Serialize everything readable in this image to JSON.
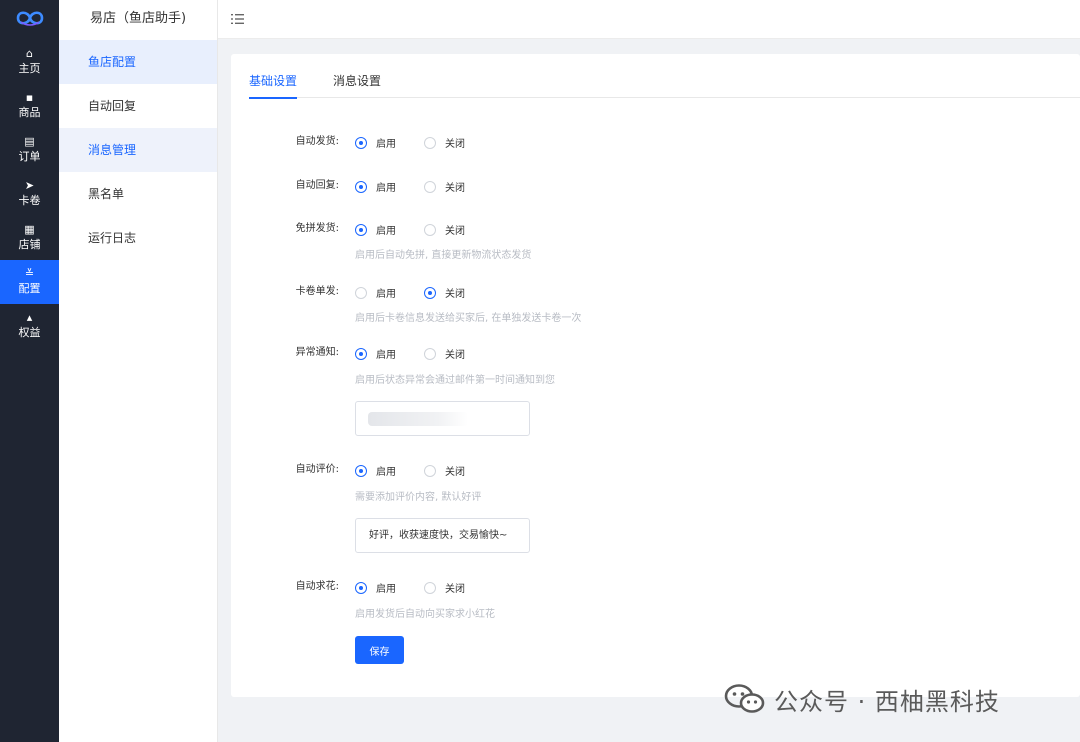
{
  "rail": {
    "items": [
      {
        "label": "主页",
        "icon": "home-icon"
      },
      {
        "label": "商品",
        "icon": "goods-icon"
      },
      {
        "label": "订单",
        "icon": "order-icon"
      },
      {
        "label": "卡卷",
        "icon": "send-icon"
      },
      {
        "label": "店铺",
        "icon": "grid-icon"
      },
      {
        "label": "配置",
        "icon": "sliders-icon"
      },
      {
        "label": "权益",
        "icon": "thumb-icon"
      }
    ],
    "active": "配置"
  },
  "sidebar": {
    "title": "易店（鱼店助手)",
    "items": [
      {
        "label": "鱼店配置"
      },
      {
        "label": "自动回复"
      },
      {
        "label": "消息管理"
      },
      {
        "label": "黑名单"
      },
      {
        "label": "运行日志"
      }
    ]
  },
  "tabs": [
    {
      "label": "基础设置",
      "active": true
    },
    {
      "label": "消息设置",
      "active": false
    }
  ],
  "form": {
    "on_label": "启用",
    "off_label": "关闭",
    "auto_ship": {
      "label": "自动发货:",
      "value": "启用"
    },
    "auto_reply": {
      "label": "自动回复:",
      "value": "启用"
    },
    "free_group": {
      "label": "免拼发货:",
      "value": "启用",
      "hint": "启用后自动免拼, 直接更新物流状态发货"
    },
    "card_single": {
      "label": "卡卷单发:",
      "value": "关闭",
      "hint": "启用后卡卷信息发送给买家后, 在单独发送卡卷一次"
    },
    "abnormal": {
      "label": "异常通知:",
      "value": "启用",
      "hint": "启用后状态异常会通过邮件第一时间通知到您",
      "email_value": ""
    },
    "auto_review": {
      "label": "自动评价:",
      "value": "启用",
      "hint": "需要添加评价内容, 默认好评",
      "review_text": "好评，收获速度快，交易愉快~"
    },
    "auto_flower": {
      "label": "自动求花:",
      "value": "启用",
      "hint": "启用发货后自动向买家求小红花"
    },
    "save_label": "保存"
  },
  "watermark": {
    "text": "公众号 · 西柚黑科技"
  },
  "colors": {
    "accent": "#1a66ff",
    "rail_bg": "#1f2532",
    "page_bg": "#f0f2f5"
  }
}
